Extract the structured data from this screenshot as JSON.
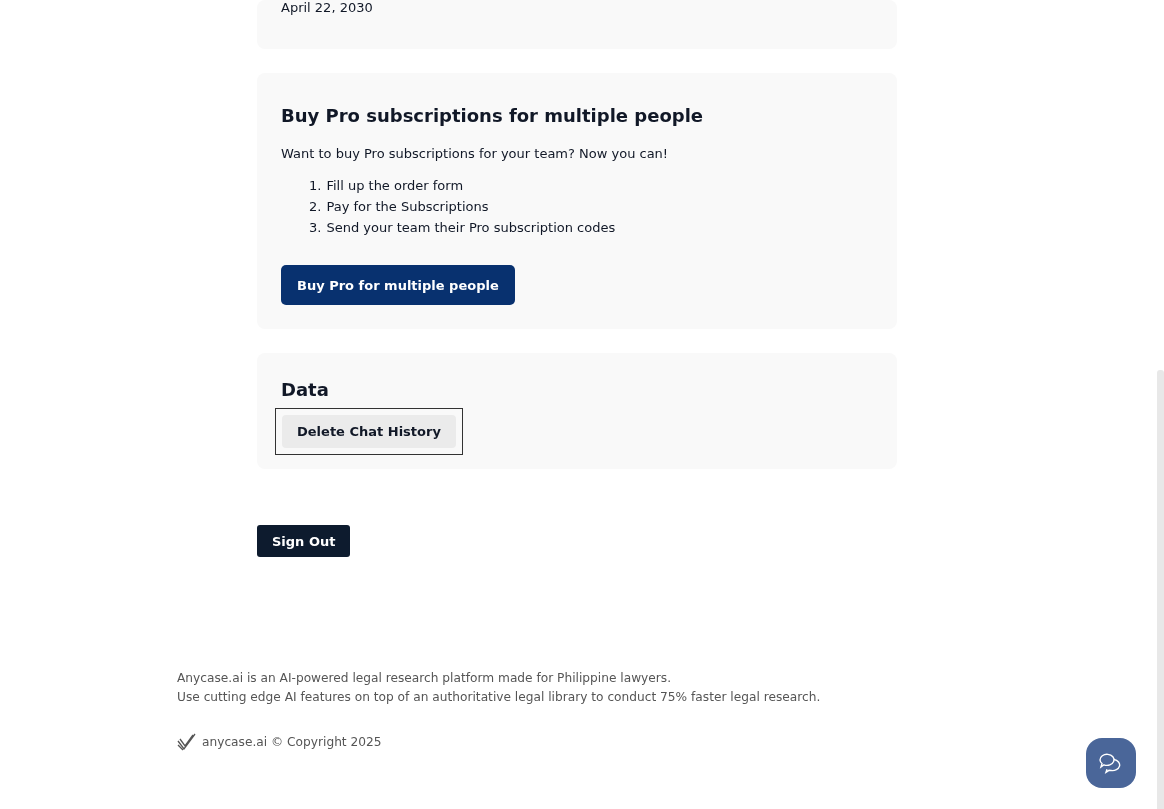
{
  "subscription_card": {
    "date": "April 22, 2030"
  },
  "team_card": {
    "title": "Buy Pro subscriptions for multiple people",
    "intro": "Want to buy Pro subscriptions for your team? Now you can!",
    "steps": [
      {
        "number": "1.",
        "text": "Fill up the order form"
      },
      {
        "number": "2.",
        "text": "Pay for the Subscriptions"
      },
      {
        "number": "3.",
        "text": "Send your team their Pro subscription codes"
      }
    ],
    "button": "Buy Pro for multiple people"
  },
  "data_card": {
    "title": "Data",
    "button": {
      "label": "Delete Chat History",
      "focused": true
    }
  },
  "sign_out": "Sign Out",
  "footer": {
    "lines": [
      "Anycase.ai is an AI-powered legal research platform made for Philippine lawyers.",
      "Use cutting edge AI features on top of an authoritative legal library to conduct 75% faster legal research."
    ],
    "copyright": "anycase.ai © Copyright 2025"
  }
}
